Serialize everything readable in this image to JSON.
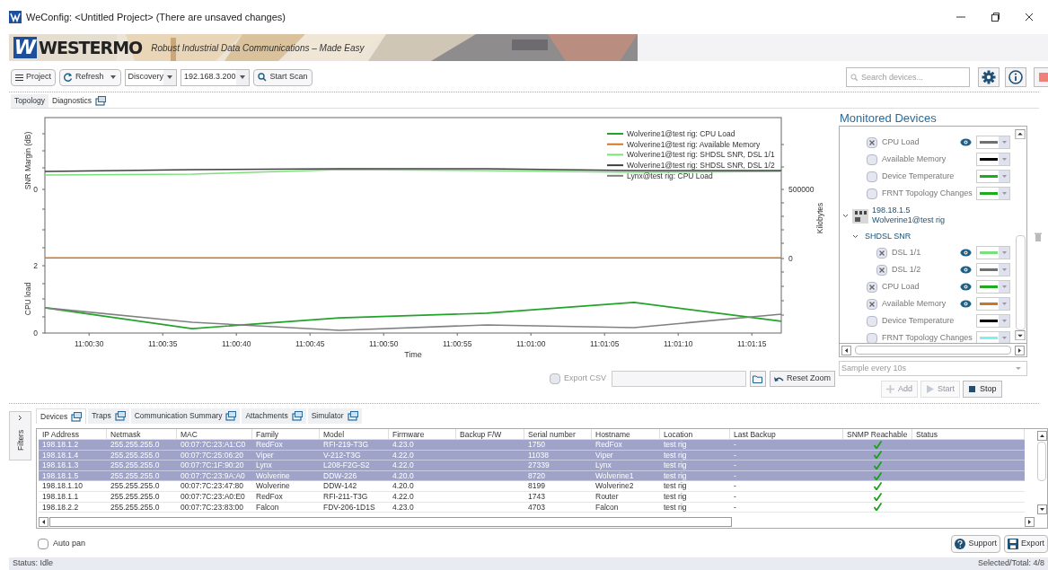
{
  "window": {
    "title": "WeConfig: <Untitled Project> (There are unsaved changes)"
  },
  "banner": {
    "logo_mark": "W",
    "brand": "WESTERMO",
    "tagline": "Robust Industrial Data Communications – Made Easy"
  },
  "toolbar": {
    "project": "Project",
    "refresh": "Refresh",
    "mode": "Discovery",
    "address": "192.168.3.200",
    "scan": "Start Scan",
    "search": {
      "placeholder": "Search devices..."
    }
  },
  "view_tabs": [
    {
      "label": "Topology",
      "selected": false,
      "popout": false
    },
    {
      "label": "Diagnostics",
      "selected": true,
      "popout": true
    }
  ],
  "diagnostics": {
    "chart_data": {
      "type": "line",
      "xlabel": "Time",
      "ylabel": "CPU load",
      "x": [
        39627,
        39637,
        39647,
        39657,
        39667,
        39677
      ],
      "xlim": [
        39627,
        39677
      ],
      "ylim": [
        0,
        6.4
      ],
      "xticks": [
        {
          "value": 39630,
          "label": "11:00:30"
        },
        {
          "value": 39635,
          "label": "11:00:35"
        },
        {
          "value": 39640,
          "label": "11:00:40"
        },
        {
          "value": 39645,
          "label": "11:00:45"
        },
        {
          "value": 39650,
          "label": "11:00:50"
        },
        {
          "value": 39655,
          "label": "11:00:55"
        },
        {
          "value": 39660,
          "label": "11:01:00"
        },
        {
          "value": 39665,
          "label": "11:01:05"
        },
        {
          "value": 39670,
          "label": "11:01:10"
        },
        {
          "value": 39675,
          "label": "11:01:15"
        }
      ],
      "yticks": [
        0,
        2
      ],
      "legend": "upper right",
      "y2label": "SNR Margin (dB)",
      "y3label": "Kilobytes",
      "y3lim": [
        -538961,
        1019481
      ],
      "y3ticks": [
        500000,
        0
      ],
      "series": [
        {
          "name": "Wolverine1@test rig: CPU Load",
          "color": "#22a32a",
          "values": [
            0.75,
            0.13,
            0.45,
            0.59,
            0.91,
            0.35
          ]
        },
        {
          "name": "Wolverine1@test rig: Available Memory",
          "color": "#c8782a",
          "axis": "y3",
          "values": [
            5000,
            5000,
            5000,
            5000,
            5000,
            5000
          ]
        },
        {
          "name": "Wolverine1@test rig: SHDSL SNR, DSL 1/1",
          "color": "#7be07b",
          "axis": "y2",
          "values": [
            null,
            null,
            null,
            null,
            null,
            null
          ]
        },
        {
          "name": "Wolverine1@test rig: SHDSL SNR, DSL 1/2",
          "color": "#404040",
          "axis": "y2",
          "values": [
            null,
            null,
            null,
            null,
            null,
            null
          ]
        },
        {
          "name": "Lynx@test rig: CPU Load",
          "color": "#808080",
          "values": [
            0.75,
            0.32,
            0.08,
            0.24,
            0.16,
            0.56
          ]
        }
      ]
    },
    "snr_tick_label": "0",
    "export": {
      "label": "Export CSV",
      "checked": false
    },
    "reset_zoom": "Reset Zoom"
  },
  "monitor": {
    "title": "Monitored Devices",
    "tree": [
      {
        "kind": "metric",
        "label": "CPU Load",
        "checked": true,
        "color": "#707070"
      },
      {
        "kind": "metric",
        "label": "Available Memory",
        "checked": false,
        "color": "#000000"
      },
      {
        "kind": "metric",
        "label": "Device Temperature",
        "checked": false,
        "color": "#1faa1f"
      },
      {
        "kind": "metric",
        "label": "FRNT Topology Changes",
        "checked": false,
        "color": "#1faa1f"
      },
      {
        "kind": "device",
        "ip": "198.18.1.5",
        "name": "Wolverine1@test rig",
        "expanded": true,
        "children": [
          {
            "kind": "group",
            "label": "SHDSL SNR",
            "expanded": true,
            "children": [
              {
                "kind": "metric",
                "label": "DSL 1/1",
                "checked": true,
                "color": "#7be07b"
              },
              {
                "kind": "metric",
                "label": "DSL 1/2",
                "checked": true,
                "color": "#707070"
              }
            ]
          },
          {
            "kind": "metric",
            "label": "CPU Load",
            "checked": true,
            "color": "#1faa1f"
          },
          {
            "kind": "metric",
            "label": "Available Memory",
            "checked": true,
            "color": "#c8782a"
          },
          {
            "kind": "metric",
            "label": "Device Temperature",
            "checked": false,
            "color": "#000000"
          },
          {
            "kind": "metric",
            "label": "FRNT Topology Changes",
            "checked": false,
            "color": "#7ef0f5"
          }
        ]
      }
    ],
    "sample": "Sample every 10s",
    "buttons": [
      {
        "kind": "add",
        "label": "Add",
        "disabled": true
      },
      {
        "kind": "start",
        "label": "Start",
        "disabled": true
      },
      {
        "kind": "stop",
        "label": "Stop",
        "disabled": false
      }
    ]
  },
  "filters": "Filters",
  "bottom_tabs": [
    {
      "label": "Devices",
      "selected": true
    },
    {
      "label": "Traps",
      "selected": false
    },
    {
      "label": "Communication Summary",
      "selected": false
    },
    {
      "label": "Attachments",
      "selected": false
    },
    {
      "label": "Simulator",
      "selected": false
    }
  ],
  "table": {
    "columns": [
      "IP Address",
      "Netmask",
      "MAC",
      "Family",
      "Model",
      "Firmware",
      "Backup F/W",
      "Serial number",
      "Hostname",
      "Location",
      "Last Backup",
      "SNMP Reachable",
      "Status"
    ],
    "rows": [
      {
        "ip": "198.18.1.2",
        "netmask": "255.255.255.0",
        "mac": "00:07:7C:23:A1:C0",
        "family": "RedFox",
        "model": "RFI-219-T3G",
        "firmware": "4.23.0",
        "serial": "1750",
        "hostname": "RedFox",
        "location": "test rig",
        "last_backup": "-",
        "snmp_reachable": true,
        "selected": true
      },
      {
        "ip": "198.18.1.4",
        "netmask": "255.255.255.0",
        "mac": "00:07:7C:25:06:20",
        "family": "Viper",
        "model": "V-212-T3G",
        "firmware": "4.22.0",
        "serial": "11038",
        "hostname": "Viper",
        "location": "test rig",
        "last_backup": "-",
        "snmp_reachable": true,
        "selected": true
      },
      {
        "ip": "198.18.1.3",
        "netmask": "255.255.255.0",
        "mac": "00:07:7C:1F:90:20",
        "family": "Lynx",
        "model": "L208-F2G-S2",
        "firmware": "4.22.0",
        "serial": "27339",
        "hostname": "Lynx",
        "location": "test rig",
        "last_backup": "-",
        "snmp_reachable": true,
        "selected": true
      },
      {
        "ip": "198.18.1.5",
        "netmask": "255.255.255.0",
        "mac": "00:07:7C:23:9A:A0",
        "family": "Wolverine",
        "model": "DDW-226",
        "firmware": "4.20.0",
        "serial": "8720",
        "hostname": "Wolverine1",
        "location": "test rig",
        "last_backup": "-",
        "snmp_reachable": true,
        "selected": true
      },
      {
        "ip": "198.18.1.10",
        "netmask": "255.255.255.0",
        "mac": "00:07:7C:23:47:80",
        "family": "Wolverine",
        "model": "DDW-142",
        "firmware": "4.20.0",
        "serial": "8199",
        "hostname": "Wolverine2",
        "location": "test rig",
        "last_backup": "-",
        "snmp_reachable": true,
        "selected": false
      },
      {
        "ip": "198.18.1.1",
        "netmask": "255.255.255.0",
        "mac": "00:07:7C:23:A0:E0",
        "family": "RedFox",
        "model": "RFI-211-T3G",
        "firmware": "4.22.0",
        "serial": "1743",
        "hostname": "Router",
        "location": "test rig",
        "last_backup": "-",
        "snmp_reachable": true,
        "selected": false
      },
      {
        "ip": "198.18.2.2",
        "netmask": "255.255.255.0",
        "mac": "00:07:7C:23:83:00",
        "family": "Falcon",
        "model": "FDV-206-1D1S",
        "firmware": "4.23.0",
        "serial": "4703",
        "hostname": "Falcon",
        "location": "test rig",
        "last_backup": "-",
        "snmp_reachable": true,
        "selected": false
      }
    ]
  },
  "auto_pan": {
    "label": "Auto pan",
    "checked": false
  },
  "buttons": [
    {
      "kind": "support",
      "label": "Support"
    },
    {
      "kind": "export",
      "label": "Export"
    }
  ],
  "status_bar": {
    "status": "Status: Idle",
    "selection": "Selected/Total: 4/8"
  }
}
